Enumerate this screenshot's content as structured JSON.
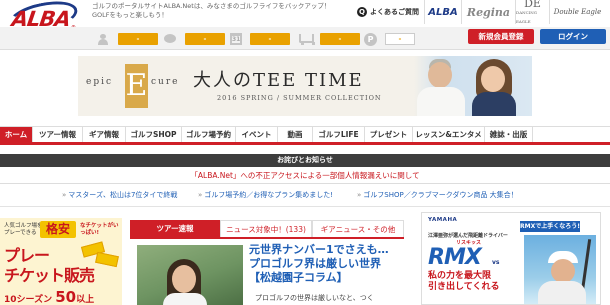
{
  "header": {
    "logo_text": "ALBA",
    "logo_reg": "®",
    "tagline": "ゴルフのポータルサイトALBA.Netは、みなさまのゴルフライフをバックアップ！GOLFをもっと楽しもう！",
    "faq_label": "よくあるご質問",
    "faq_icon_glyph": "Q",
    "brands": {
      "alba": "ALBA",
      "regina": "Regina",
      "de": "DE",
      "de_sub": "DANCING EAGLE",
      "eagle": "Double Eagle"
    }
  },
  "userbar": {
    "items": [
      {
        "icon": "person-icon",
        "value": "-"
      },
      {
        "icon": "chat-bubble-icon",
        "value": "-"
      },
      {
        "icon": "calendar-icon",
        "icon_label": "31",
        "value": "-"
      },
      {
        "icon": "cart-icon",
        "value": "-"
      },
      {
        "icon": "points-icon",
        "icon_label": "P",
        "value": "-"
      }
    ],
    "register_label": "新規会員登録",
    "login_label": "ログイン",
    "accent_color": "#e9a100"
  },
  "banner": {
    "brand_left": "epic",
    "brand_e": "E",
    "brand_right": "cure",
    "title": "大人のTEE TIME",
    "subtitle": "2016 SPRING / SUMMER COLLECTION"
  },
  "nav": {
    "items": [
      {
        "label": "ホーム",
        "active": true
      },
      {
        "label": "ツアー情報",
        "active": false
      },
      {
        "label": "ギア情報",
        "active": false
      },
      {
        "label": "ゴルフSHOP",
        "active": false
      },
      {
        "label": "ゴルフ場予約",
        "active": false
      },
      {
        "label": "イベント",
        "active": false
      },
      {
        "label": "動画",
        "active": false
      },
      {
        "label": "ゴルフLIFE",
        "active": false
      },
      {
        "label": "プレゼント",
        "active": false
      },
      {
        "label": "レッスン&エンタメ",
        "active": false
      },
      {
        "label": "雑誌・出版",
        "active": false
      }
    ],
    "active_color": "#cf1f27"
  },
  "notice": {
    "bar_label": "お詫びとお知らせ",
    "link_text": "「ALBA.Net」への不正アクセスによる一部個人情報漏えいに関して"
  },
  "ticker": {
    "items": [
      "マスターズ、松山は7位タイで終戦",
      "ゴルフ場予約／お得なプラン集めました!",
      "ゴルフSHOP／クラブマークダウン商品 大集合！"
    ],
    "arrow": "»"
  },
  "left_ad": {
    "top_text": "人気ゴルフ場をプレーできる",
    "kakuyasu": "格安",
    "side_text": "なチケットがいっぱい!",
    "big_text_1": "プレー",
    "big_text_2": "チケット販売",
    "season_prefix": "10",
    "season_text": "シーズン",
    "season_count": "50",
    "season_suffix": "以上"
  },
  "tabs": {
    "items": [
      {
        "label": "ツアー速報",
        "active": true
      },
      {
        "label": "ニュース対象中！(133)",
        "active": false
      },
      {
        "label": "ギアニュース・その他",
        "active": false
      }
    ]
  },
  "article": {
    "title": "元世界ナンバー1でさえも…プロゴルフ界は厳しい世界【松越園子コラム】",
    "body": "プロゴルフの世界は厳しいなと、つく"
  },
  "right_ad": {
    "maker": "YAMAHA",
    "rmx_pill": "RMXで上手くなろう!",
    "sub": "江澤亜弥が選んだ飛距離ドライバー",
    "risky": "リスキッス",
    "logo": "RMX",
    "vs": "vs",
    "copy_1": "私の力を最大限",
    "copy_2": "引き出してくれる"
  }
}
